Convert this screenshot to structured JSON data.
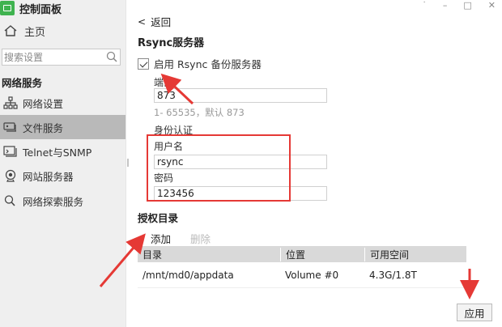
{
  "app": {
    "title": "控制面板"
  },
  "sidebar": {
    "home_label": "主页",
    "search_placeholder": "搜索设置",
    "section_title": "网络服务",
    "items": [
      {
        "label": "网络设置",
        "icon": "network-icon"
      },
      {
        "label": "文件服务",
        "icon": "file-service-icon",
        "active": true
      },
      {
        "label": "Telnet与SNMP",
        "icon": "terminal-icon"
      },
      {
        "label": "网站服务器",
        "icon": "web-server-icon"
      },
      {
        "label": "网络探索服务",
        "icon": "discovery-icon"
      }
    ]
  },
  "window": {
    "minimize": "–",
    "maximize": "□",
    "close": "✕",
    "top_dots": "˙"
  },
  "main": {
    "back_label": "返回",
    "title": "Rsync服务器",
    "enable_label": "启用 Rsync 备份服务器",
    "enable_checked": true,
    "port_label": "端口",
    "port_value": "873",
    "port_hint": "1- 65535，默认 873",
    "auth_label": "身份认证",
    "username_label": "用户名",
    "username_value": "rsync",
    "password_label": "密码",
    "password_value": "123456",
    "auth_dir_title": "授权目录",
    "add_label": "添加",
    "delete_label": "删除",
    "table": {
      "headers": [
        "目录",
        "位置",
        "可用空间"
      ],
      "rows": [
        [
          "/mnt/md0/appdata",
          "Volume #0",
          "4.3G/1.8T"
        ]
      ]
    },
    "apply_label": "应用"
  },
  "colors": {
    "accent": "#3fb34f",
    "annotation": "#e53935",
    "active_nav": "#b9b9b9"
  }
}
